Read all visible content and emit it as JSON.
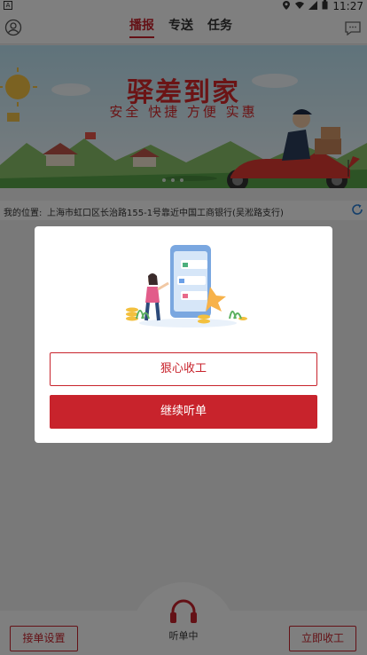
{
  "statusbar": {
    "indicator": "A",
    "time": "11:27"
  },
  "header": {
    "tabs": [
      {
        "label": "播报",
        "active": true
      },
      {
        "label": "专送",
        "active": false
      },
      {
        "label": "任务",
        "active": false
      }
    ]
  },
  "banner": {
    "title": "驿差到家",
    "subtitle": "安全 快捷 方便 实惠"
  },
  "location": {
    "label": "我的位置:",
    "address": "上海市虹口区长治路155-1号靠近中国工商银行(吴淞路支行)"
  },
  "bottom": {
    "settings_label": "接单设置",
    "listening_label": "听单中",
    "stop_label": "立即收工"
  },
  "dialog": {
    "quit_label": "狠心收工",
    "continue_label": "继续听单"
  },
  "colors": {
    "accent": "#c8232c"
  }
}
